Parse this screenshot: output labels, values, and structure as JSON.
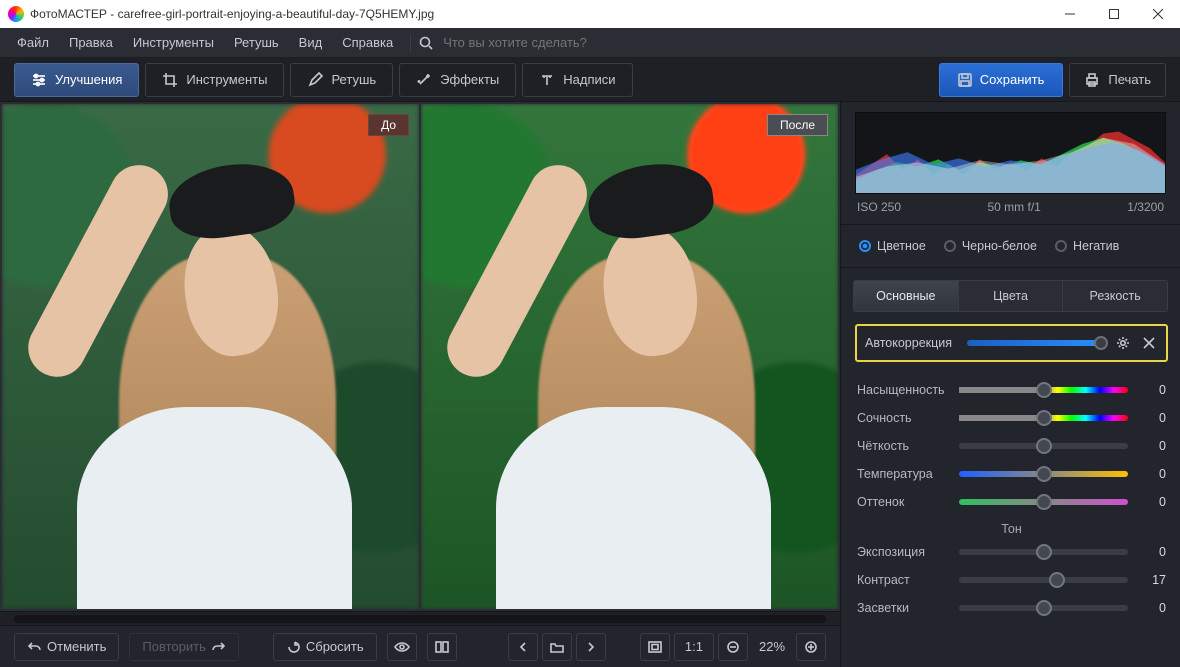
{
  "window": {
    "title": "ФотоМАСТЕР - carefree-girl-portrait-enjoying-a-beautiful-day-7Q5HEMY.jpg"
  },
  "menubar": {
    "file": "Файл",
    "edit": "Правка",
    "tools": "Инструменты",
    "retouch": "Ретушь",
    "view": "Вид",
    "help": "Справка",
    "search_ph": "Что вы хотите сделать?"
  },
  "tabs": {
    "enhance": "Улучшения",
    "tools": "Инструменты",
    "retouch": "Ретушь",
    "effects": "Эффекты",
    "text": "Надписи"
  },
  "actions": {
    "save": "Сохранить",
    "print": "Печать"
  },
  "compare": {
    "before": "До",
    "after": "После"
  },
  "footer": {
    "undo": "Отменить",
    "redo": "Повторить",
    "reset": "Сбросить",
    "fit": "1:1",
    "zoom": "22%"
  },
  "meta": {
    "iso": "ISO 250",
    "lens": "50 mm f/1",
    "shutter": "1/3200"
  },
  "color_modes": {
    "color": "Цветное",
    "bw": "Черно-белое",
    "neg": "Негатив"
  },
  "subtabs": {
    "basic": "Основные",
    "colors": "Цвета",
    "sharp": "Резкость"
  },
  "auto": {
    "label": "Автокоррекция"
  },
  "sliders": {
    "saturation": {
      "label": "Насыщенность",
      "value": "0"
    },
    "vibrance": {
      "label": "Сочность",
      "value": "0"
    },
    "clarity": {
      "label": "Чёткость",
      "value": "0"
    },
    "temperature": {
      "label": "Температура",
      "value": "0"
    },
    "tint": {
      "label": "Оттенок",
      "value": "0"
    },
    "tone_title": "Тон",
    "exposure": {
      "label": "Экспозиция",
      "value": "0"
    },
    "contrast": {
      "label": "Контраст",
      "value": "17"
    },
    "highlights": {
      "label": "Засветки",
      "value": "0"
    }
  }
}
